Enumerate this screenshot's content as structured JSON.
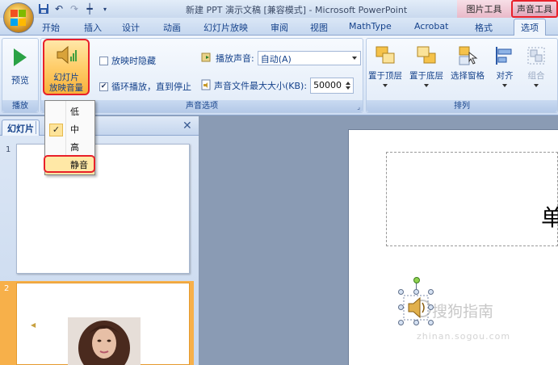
{
  "window": {
    "title": "新建 PPT 演示文稿 [兼容模式] - Microsoft PowerPoint",
    "context_picture_tools": "图片工具",
    "context_sound_tools": "声音工具"
  },
  "tabs": [
    "开始",
    "插入",
    "设计",
    "动画",
    "幻灯片放映",
    "审阅",
    "视图",
    "MathType",
    "Acrobat",
    "格式",
    "选项"
  ],
  "active_tab": "选项",
  "ribbon": {
    "play_group": {
      "preview_label": "预览",
      "group_label": "播放"
    },
    "volume_button": {
      "line1": "幻灯片",
      "line2": "放映音量"
    },
    "sound_options": {
      "hide_during_show": "放映时隐藏",
      "loop_until_stopped": "循环播放，直到停止",
      "play_sound_label": "播放声音:",
      "play_sound_value": "自动(A)",
      "max_size_label": "声音文件最大大小(KB):",
      "max_size_value": "50000",
      "group_label": "声音选项",
      "hide_checked": false,
      "loop_checked": true
    },
    "arrange": {
      "bring_front": "置于顶层",
      "send_back": "置于底层",
      "selection_pane": "选择窗格",
      "align": "对齐",
      "group": "组合",
      "group_label": "排列"
    }
  },
  "volume_menu": {
    "items": [
      "低",
      "中",
      "高",
      "静音"
    ],
    "checked": "中",
    "check_mark": "✓"
  },
  "slides_pane": {
    "tab_label": "幻灯片",
    "close_glyph": "✕",
    "slide_numbers": [
      "1",
      "2"
    ]
  },
  "slide": {
    "title_glyph": "单"
  },
  "watermark": {
    "text": "搜狗指南",
    "sub": "zhinan.sogou.com"
  },
  "colors": {
    "highlight_ring": "#e8202a",
    "ribbon_text": "#15428b",
    "selected_thumb": "#f7b04a"
  }
}
